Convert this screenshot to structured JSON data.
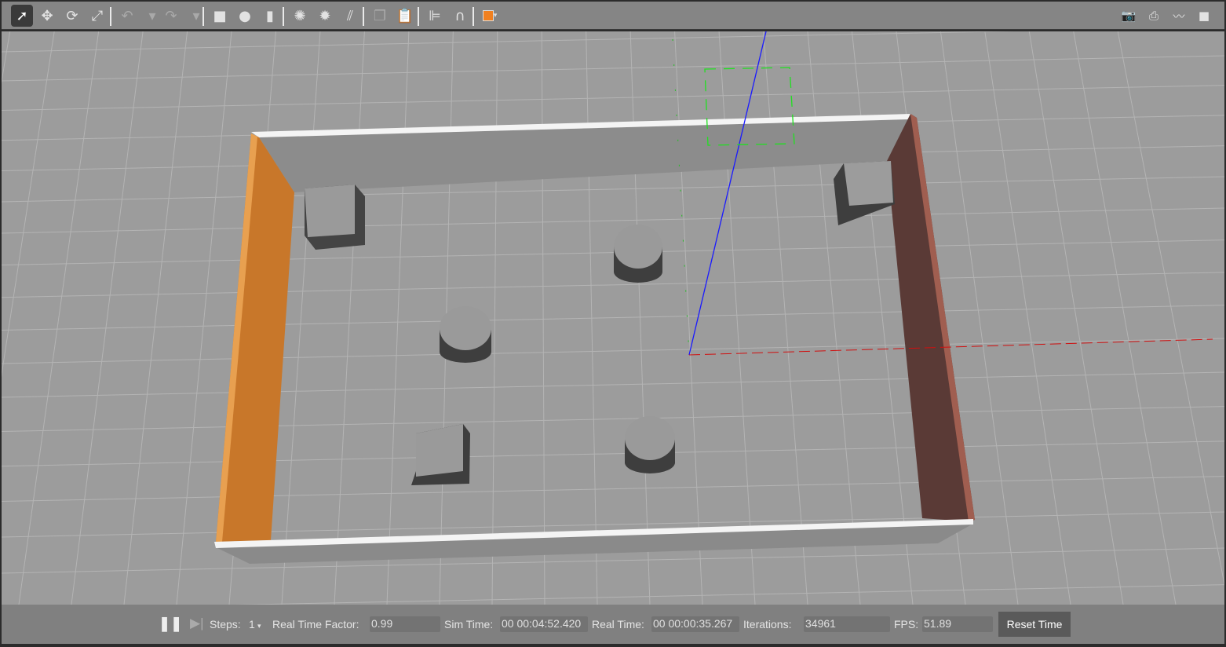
{
  "toolbar": {
    "tools": [
      {
        "name": "select-mode-icon",
        "glyph": "➚",
        "active": true
      },
      {
        "name": "translate-mode-icon",
        "glyph": "✥"
      },
      {
        "name": "rotate-mode-icon",
        "glyph": "⟳"
      },
      {
        "name": "scale-mode-icon",
        "glyph": "⤢"
      }
    ],
    "history": [
      {
        "name": "undo-icon",
        "glyph": "↶"
      },
      {
        "name": "undo-dropdown-icon",
        "glyph": "▾"
      },
      {
        "name": "redo-icon",
        "glyph": "↷"
      },
      {
        "name": "redo-dropdown-icon",
        "glyph": "▾"
      }
    ],
    "shapes": [
      {
        "name": "box-shape-icon",
        "glyph": "■"
      },
      {
        "name": "sphere-shape-icon",
        "glyph": "●"
      },
      {
        "name": "cylinder-shape-icon",
        "glyph": "▮"
      }
    ],
    "lights": [
      {
        "name": "point-light-icon",
        "glyph": "✺"
      },
      {
        "name": "spot-light-icon",
        "glyph": "✹"
      },
      {
        "name": "directional-light-icon",
        "glyph": "⫽"
      }
    ],
    "edit": [
      {
        "name": "copy-icon",
        "glyph": "❐"
      },
      {
        "name": "paste-icon",
        "glyph": "📋"
      }
    ],
    "align": [
      {
        "name": "align-icon",
        "glyph": "⊫"
      },
      {
        "name": "snap-magnet-icon",
        "glyph": "∩"
      }
    ],
    "view_icon": "view-angle-cube-icon",
    "right": [
      {
        "name": "screenshot-camera-icon",
        "glyph": "📷"
      },
      {
        "name": "log-icon",
        "glyph": "⎙"
      },
      {
        "name": "plot-icon",
        "glyph": "〰"
      },
      {
        "name": "video-record-icon",
        "glyph": "■"
      }
    ],
    "accent": "#f08020"
  },
  "bottom": {
    "steps_label": "Steps:",
    "steps_value": "1",
    "rtf_label": "Real Time Factor:",
    "rtf_value": "0.99",
    "sim_time_label": "Sim Time:",
    "sim_time_value": "00 00:04:52.420",
    "real_time_label": "Real Time:",
    "real_time_value": "00 00:00:35.267",
    "iterations_label": "Iterations:",
    "iterations_value": "34961",
    "fps_label": "FPS:",
    "fps_value": "51.89",
    "reset_label": "Reset Time"
  }
}
